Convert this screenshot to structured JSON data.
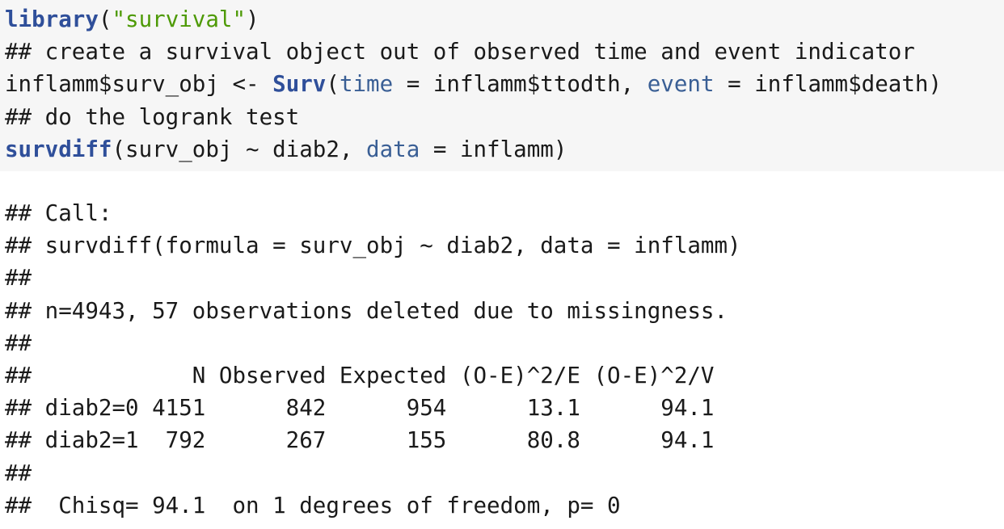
{
  "code": {
    "line1": {
      "fn": "library",
      "open": "(",
      "str": "\"survival\"",
      "close": ")"
    },
    "line2": "## create a survival object out of observed time and event indicator",
    "line3": {
      "part1": "inflamm$surv_obj <- ",
      "fn": "Surv",
      "part2": "(",
      "arg1": "time",
      "eq1": " = ",
      "part3": "inflamm$ttodth, ",
      "arg2": "event",
      "eq2": " = ",
      "part4": "inflamm$death)"
    },
    "line4": "## do the logrank test",
    "line5": {
      "fn": "survdiff",
      "part1": "(surv_obj ~ diab2, ",
      "arg": "data",
      "eq": " = ",
      "part2": "inflamm)"
    }
  },
  "output": {
    "lines": [
      "## Call:",
      "## survdiff(formula = surv_obj ~ diab2, data = inflamm)",
      "##",
      "## n=4943, 57 observations deleted due to missingness.",
      "##",
      "##            N Observed Expected (O-E)^2/E (O-E)^2/V",
      "## diab2=0 4151      842      954      13.1      94.1",
      "## diab2=1  792      267      155      80.8      94.1",
      "##",
      "##  Chisq= 94.1  on 1 degrees of freedom, p= 0"
    ]
  }
}
